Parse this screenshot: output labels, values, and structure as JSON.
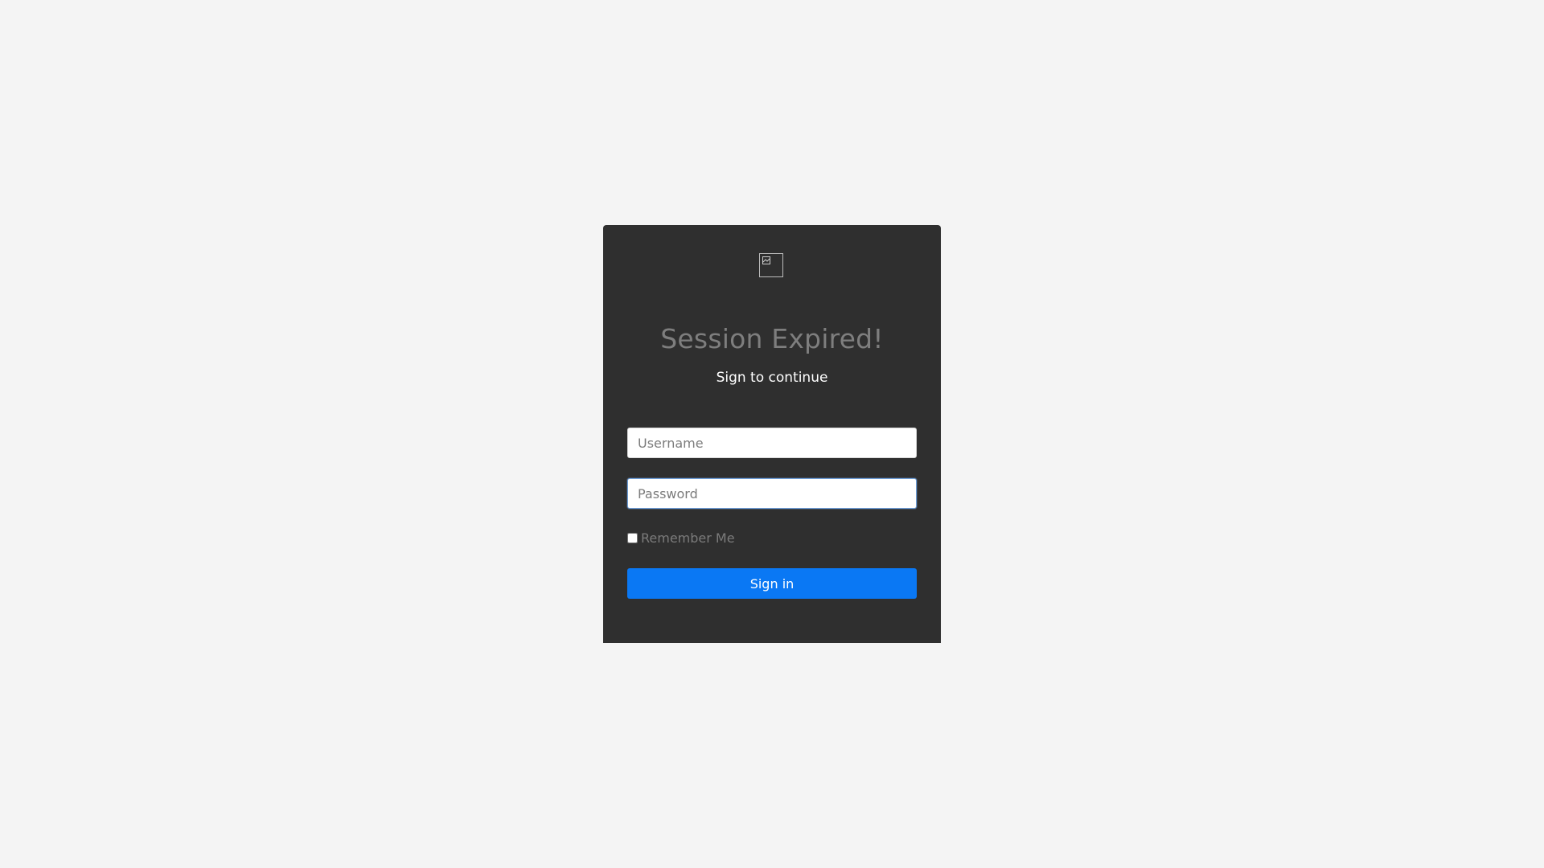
{
  "login": {
    "title": "Session Expired!",
    "subtitle": "Sign to continue",
    "username_placeholder": "Username",
    "password_placeholder": "Password",
    "remember_label": "Remember Me",
    "signin_label": "Sign in"
  },
  "logo": {
    "icon": "broken-image-icon"
  },
  "colors": {
    "page_background": "#f4f4f4",
    "card_background": "#2f2f2f",
    "button_background": "#0a78f4"
  }
}
